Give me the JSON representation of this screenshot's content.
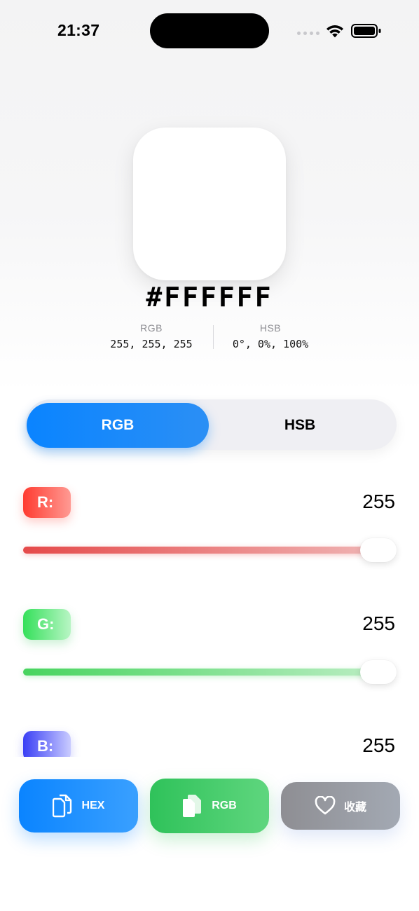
{
  "status_bar": {
    "time": "21:37",
    "icons": [
      "cellular-dots-icon",
      "wifi-icon",
      "battery-icon"
    ]
  },
  "color": {
    "swatch_color": "#FFFFFF",
    "hex": "#FFFFFF",
    "rgb_label": "RGB",
    "rgb_value": "255, 255, 255",
    "hsb_label": "HSB",
    "hsb_value": "0°, 0%, 100%"
  },
  "mode_selector": {
    "options": [
      "RGB",
      "HSB"
    ],
    "selected": "RGB",
    "accent": "#0A84FF"
  },
  "sliders": [
    {
      "label": "R:",
      "value": "255",
      "fraction": 1.0,
      "color": "#FF3B30"
    },
    {
      "label": "G:",
      "value": "255",
      "fraction": 1.0,
      "color": "#34C759"
    },
    {
      "label": "B:",
      "value": "255",
      "fraction": 1.0,
      "color": "#3A3FF5"
    }
  ],
  "actions": [
    {
      "label": "HEX",
      "icon": "copy-icon",
      "color": "#0A84FF"
    },
    {
      "label": "RGB",
      "icon": "copy-icon",
      "color": "#34C759"
    },
    {
      "label": "收藏",
      "icon": "heart-icon",
      "color": "#8E8E93"
    }
  ]
}
